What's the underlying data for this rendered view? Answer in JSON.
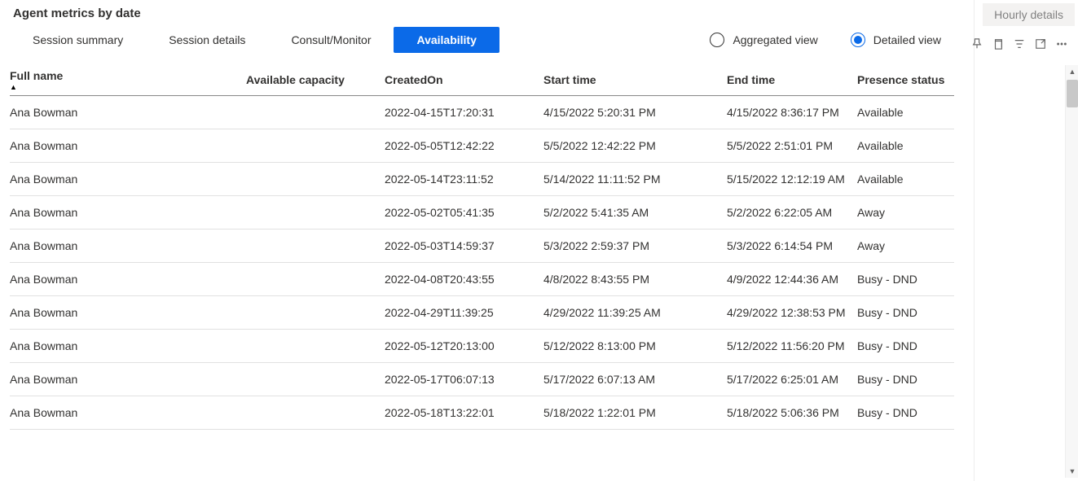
{
  "title": "Agent metrics by date",
  "tabs": [
    {
      "label": "Session summary",
      "active": false
    },
    {
      "label": "Session details",
      "active": false
    },
    {
      "label": "Consult/Monitor",
      "active": false
    },
    {
      "label": "Availability",
      "active": true
    }
  ],
  "viewOptions": {
    "aggregated": {
      "label": "Aggregated view",
      "selected": false
    },
    "detailed": {
      "label": "Detailed view",
      "selected": true
    }
  },
  "sideButton": {
    "hourly_label": "Hourly details"
  },
  "columns": [
    "Full name",
    "Available capacity",
    "CreatedOn",
    "Start time",
    "End time",
    "Presence status"
  ],
  "sort": {
    "column": 0,
    "direction": "asc"
  },
  "rows": [
    {
      "full_name": "Ana Bowman",
      "available_capacity": "",
      "created_on": "2022-04-15T17:20:31",
      "start_time": "4/15/2022 5:20:31 PM",
      "end_time": "4/15/2022 8:36:17 PM",
      "presence": "Available"
    },
    {
      "full_name": "Ana Bowman",
      "available_capacity": "",
      "created_on": "2022-05-05T12:42:22",
      "start_time": "5/5/2022 12:42:22 PM",
      "end_time": "5/5/2022 2:51:01 PM",
      "presence": "Available"
    },
    {
      "full_name": "Ana Bowman",
      "available_capacity": "",
      "created_on": "2022-05-14T23:11:52",
      "start_time": "5/14/2022 11:11:52 PM",
      "end_time": "5/15/2022 12:12:19 AM",
      "presence": "Available"
    },
    {
      "full_name": "Ana Bowman",
      "available_capacity": "",
      "created_on": "2022-05-02T05:41:35",
      "start_time": "5/2/2022 5:41:35 AM",
      "end_time": "5/2/2022 6:22:05 AM",
      "presence": "Away"
    },
    {
      "full_name": "Ana Bowman",
      "available_capacity": "",
      "created_on": "2022-05-03T14:59:37",
      "start_time": "5/3/2022 2:59:37 PM",
      "end_time": "5/3/2022 6:14:54 PM",
      "presence": "Away"
    },
    {
      "full_name": "Ana Bowman",
      "available_capacity": "",
      "created_on": "2022-04-08T20:43:55",
      "start_time": "4/8/2022 8:43:55 PM",
      "end_time": "4/9/2022 12:44:36 AM",
      "presence": "Busy - DND"
    },
    {
      "full_name": "Ana Bowman",
      "available_capacity": "",
      "created_on": "2022-04-29T11:39:25",
      "start_time": "4/29/2022 11:39:25 AM",
      "end_time": "4/29/2022 12:38:53 PM",
      "presence": "Busy - DND"
    },
    {
      "full_name": "Ana Bowman",
      "available_capacity": "",
      "created_on": "2022-05-12T20:13:00",
      "start_time": "5/12/2022 8:13:00 PM",
      "end_time": "5/12/2022 11:56:20 PM",
      "presence": "Busy - DND"
    },
    {
      "full_name": "Ana Bowman",
      "available_capacity": "",
      "created_on": "2022-05-17T06:07:13",
      "start_time": "5/17/2022 6:07:13 AM",
      "end_time": "5/17/2022 6:25:01 AM",
      "presence": "Busy - DND"
    },
    {
      "full_name": "Ana Bowman",
      "available_capacity": "",
      "created_on": "2022-05-18T13:22:01",
      "start_time": "5/18/2022 1:22:01 PM",
      "end_time": "5/18/2022 5:06:36 PM",
      "presence": "Busy - DND"
    }
  ]
}
